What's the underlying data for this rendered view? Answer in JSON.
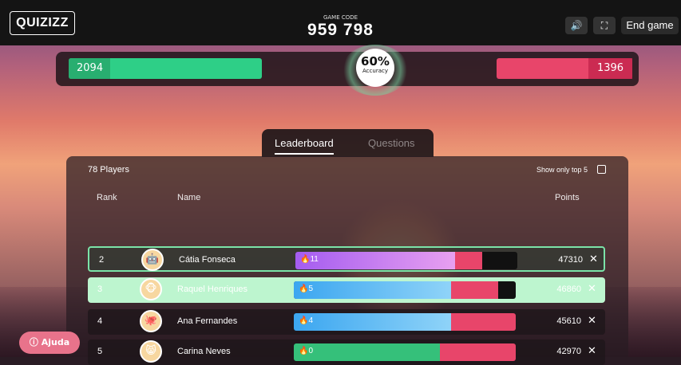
{
  "header": {
    "logo": "QUIZIZZ",
    "game_code_label": "GAME CODE",
    "game_code": "959 798",
    "sound_icon": "speaker-icon",
    "fullscreen_icon": "fullscreen-icon",
    "end_game_label": "End game"
  },
  "accuracy": {
    "correct": "2094",
    "incorrect": "1396",
    "percent": "60%",
    "label": "Accuracy",
    "colors": {
      "correct": "#2ecf87",
      "incorrect": "#e8456a"
    }
  },
  "tabs": [
    {
      "label": "Leaderboard",
      "active": true
    },
    {
      "label": "Questions",
      "active": false
    }
  ],
  "leaderboard": {
    "players_count": "78 Players",
    "show_top_label": "Show only top 5",
    "columns": {
      "rank": "Rank",
      "name": "Name",
      "points": "Points"
    },
    "rows": [
      {
        "rank": "2",
        "name": "Cátia Fonseca",
        "streak": "11",
        "points": "47310",
        "correct_fraction": 0.72,
        "incorrect_fraction": 0.12
      },
      {
        "rank": "3",
        "name": "Raquel Henriques",
        "streak": "5",
        "points": "46860",
        "correct_fraction": 0.71,
        "incorrect_fraction": 0.21
      },
      {
        "rank": "4",
        "name": "Ana Fernandes",
        "streak": "4",
        "points": "45610",
        "correct_fraction": 0.71,
        "incorrect_fraction": 0.29
      },
      {
        "rank": "5",
        "name": "Carina Neves",
        "streak": "0",
        "points": "42970",
        "correct_fraction": 0.66,
        "incorrect_fraction": 0.34
      }
    ]
  },
  "help": {
    "label": "Ajuda",
    "icon": "question-circle-icon"
  }
}
